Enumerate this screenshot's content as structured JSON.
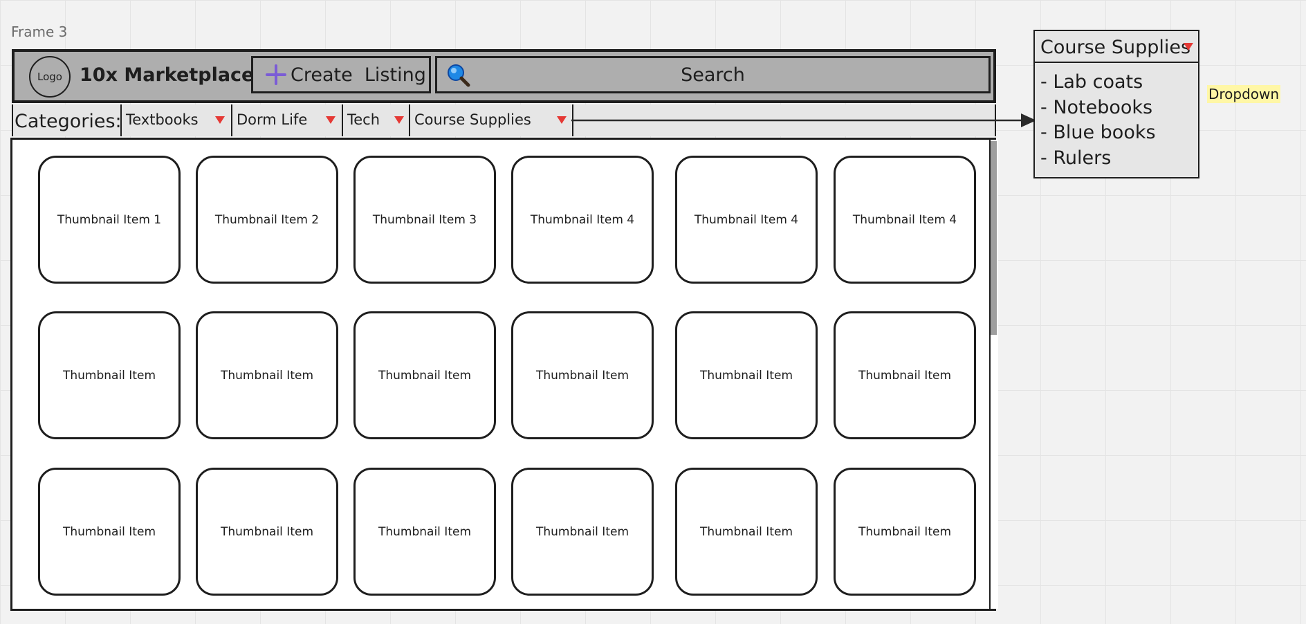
{
  "frame_label": "Frame 3",
  "header": {
    "logo_text": "Logo",
    "brand": "10x Marketplace",
    "create_button_label": "Create  Listing",
    "search_label": "Search",
    "icons": {
      "create": "plus-icon",
      "search": "search-icon"
    }
  },
  "categories": {
    "label": "Categories:",
    "items": [
      {
        "label": "Textbooks"
      },
      {
        "label": "Dorm Life"
      },
      {
        "label": "Tech"
      },
      {
        "label": "Course Supplies"
      }
    ]
  },
  "grid": {
    "rows": [
      [
        "Thumbnail Item 1",
        "Thumbnail Item 2",
        "Thumbnail Item 3",
        "Thumbnail Item 4",
        "Thumbnail Item 4",
        "Thumbnail Item 4"
      ],
      [
        "Thumbnail Item",
        "Thumbnail Item",
        "Thumbnail Item",
        "Thumbnail Item",
        "Thumbnail Item",
        "Thumbnail Item"
      ],
      [
        "Thumbnail Item",
        "Thumbnail Item",
        "Thumbnail Item",
        "Thumbnail Item",
        "Thumbnail Item",
        "Thumbnail Item"
      ]
    ]
  },
  "dropdown_preview": {
    "title": "Course Supplies",
    "items": [
      "- Lab coats",
      "- Notebooks",
      "- Blue books",
      "- Rulers"
    ],
    "note": "Dropdown"
  },
  "colors": {
    "header_bg": "#aeaeae",
    "accent_plus": "#7b5cd6",
    "dropdown_arrow": "#e53935",
    "note_bg": "#fff7a6"
  }
}
